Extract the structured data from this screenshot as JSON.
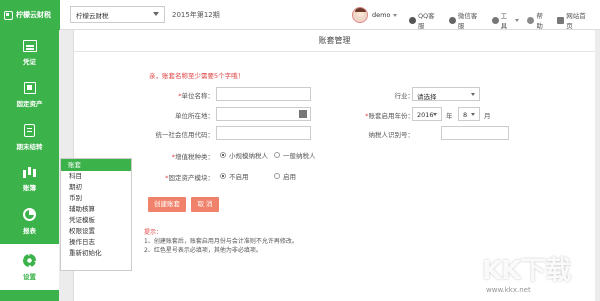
{
  "app": {
    "logo_text": "柠檬云财税"
  },
  "header": {
    "company": "柠檬云财税",
    "period": "2015年第12期",
    "user": "demo",
    "links": [
      {
        "label": "QQ客服",
        "icon": "qq-icon"
      },
      {
        "label": "微信客服",
        "icon": "wechat-icon"
      },
      {
        "label": "工具",
        "icon": "tool-icon"
      },
      {
        "label": "帮助",
        "icon": "help-icon"
      },
      {
        "label": "网站首页",
        "icon": "home-icon"
      }
    ]
  },
  "sidebar": {
    "items": [
      {
        "label": "凭证",
        "icon": "voucher-icon"
      },
      {
        "label": "固定资产",
        "icon": "asset-icon"
      },
      {
        "label": "期末结转",
        "icon": "period-close-icon"
      },
      {
        "label": "账簿",
        "icon": "books-icon"
      },
      {
        "label": "报表",
        "icon": "report-icon"
      },
      {
        "label": "设置",
        "icon": "gear-icon"
      }
    ]
  },
  "submenu": {
    "items": [
      "账套",
      "科目",
      "期初",
      "币别",
      "辅助核算",
      "凭证模板",
      "权限设置",
      "操作日志",
      "重新初始化"
    ]
  },
  "main": {
    "title": "账套管理",
    "tip": "亲，账套名称至少需要5个字哦！",
    "form": {
      "unit_name_label": "单位名称：",
      "unit_name_value": "",
      "industry_label": "行业：",
      "industry_value": "请选择",
      "location_label": "单位所在地：",
      "location_value": "",
      "start_period_label": "账套启用年份：",
      "start_year": "2016",
      "year_unit": "年",
      "start_month": "8",
      "month_unit": "月",
      "credit_code_label": "统一社会信用代码：",
      "credit_code_value": "",
      "tax_no_label": "纳税人识别号：",
      "tax_no_value": "",
      "vat_label": "增值税种类：",
      "vat_options": [
        "小规模纳税人",
        "一般纳税人"
      ],
      "asset_module_label": "固定资产模块：",
      "asset_options": [
        "不启用",
        "启用"
      ]
    },
    "buttons": {
      "create": "创建账套",
      "cancel": "取 消"
    },
    "hints": {
      "title": "提示：",
      "lines": [
        "1、创建账套后，账套启用月份与会计准则不允许再修改。",
        "2、红色星号表示必填项，其他为非必填项。"
      ]
    }
  },
  "watermark": {
    "text": "KK下载",
    "url": "www.kkx.net"
  },
  "colors": {
    "brand_green": "#3cb24a",
    "button_orange": "#f0826b",
    "tip_red": "#e04040"
  }
}
